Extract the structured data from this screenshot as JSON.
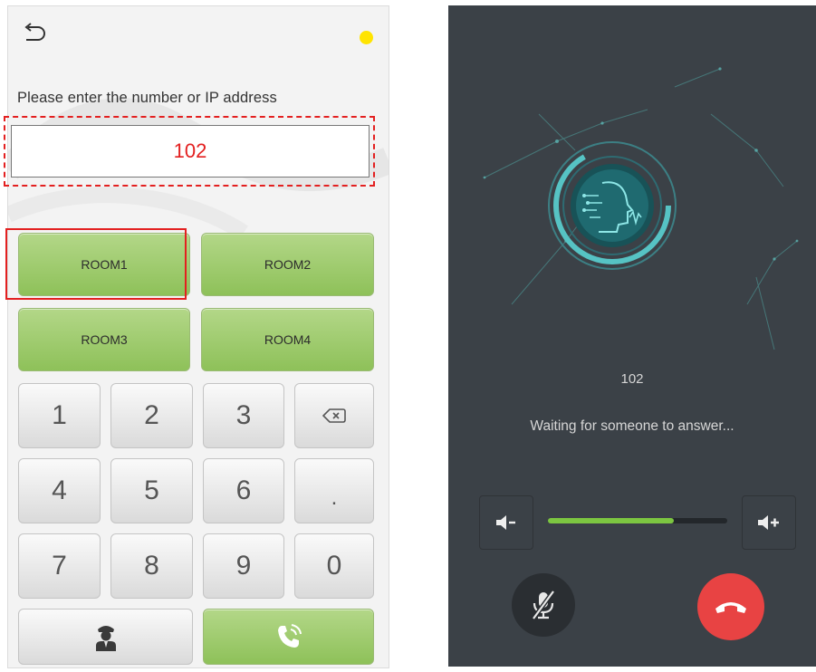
{
  "left_screen": {
    "prompt": "Please enter the number or IP address",
    "input_value": "102",
    "room_buttons": [
      "ROOM1",
      "ROOM2",
      "ROOM3",
      "ROOM4"
    ],
    "keypad": [
      "1",
      "2",
      "3",
      "4",
      "5",
      "6",
      ".",
      "7",
      "8",
      "9",
      "0"
    ],
    "icons": {
      "back": "back-arrow-icon",
      "status": "status-dot",
      "backspace": "backspace-icon",
      "guard": "security-guard-icon",
      "call": "phone-call-icon"
    },
    "colors": {
      "status_dot": "#ffe400",
      "highlight": "#e32020",
      "room_button": "#9ccb6a"
    }
  },
  "right_screen": {
    "caller_number": "102",
    "status_text": "Waiting for someone to answer...",
    "volume_level": 0.7,
    "icons": {
      "volume_down": "volume-down-icon",
      "volume_up": "volume-up-icon",
      "mute": "mic-mute-icon",
      "hangup": "hang-up-icon"
    },
    "colors": {
      "background": "#3b4147",
      "volume_fill": "#7cc641",
      "hangup": "#e84343"
    }
  }
}
